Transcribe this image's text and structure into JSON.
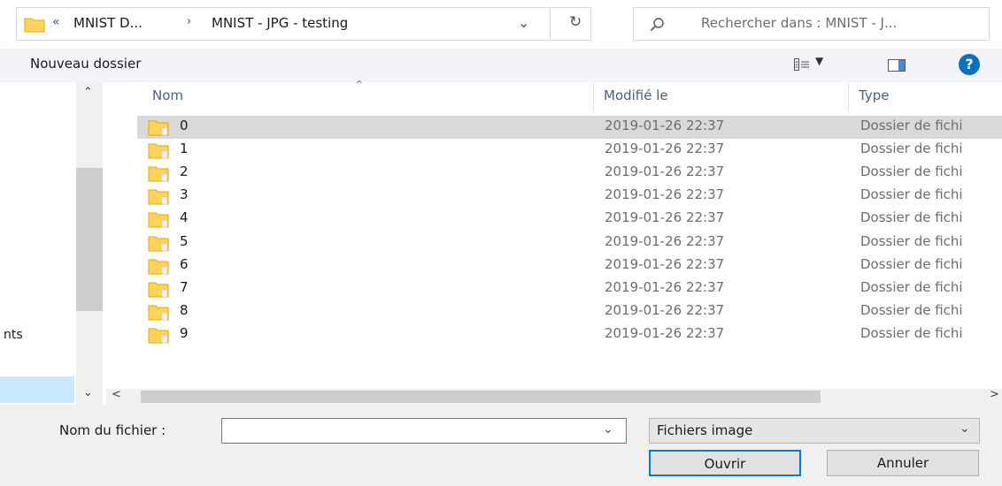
{
  "address": {
    "chevron": "«",
    "segment1": "MNIST D...",
    "separator": "›",
    "segment2": "MNIST - JPG - testing",
    "dropdown": "⌄",
    "refresh": "↻"
  },
  "search": {
    "placeholder": "Rechercher dans : MNIST - J..."
  },
  "toolbar": {
    "new_folder": "Nouveau dossier",
    "view_dropdown": "▼",
    "help": "?"
  },
  "nav": {
    "partial_label": "nts",
    "scroll_up": "⌃",
    "scroll_down": "⌄"
  },
  "list": {
    "sort_arrow": "⌃",
    "columns": {
      "name": "Nom",
      "modified": "Modifié le",
      "type": "Type"
    },
    "rows": [
      {
        "name": "0",
        "modified": "2019-01-26 22:37",
        "type": "Dossier de fichi"
      },
      {
        "name": "1",
        "modified": "2019-01-26 22:37",
        "type": "Dossier de fichi"
      },
      {
        "name": "2",
        "modified": "2019-01-26 22:37",
        "type": "Dossier de fichi"
      },
      {
        "name": "3",
        "modified": "2019-01-26 22:37",
        "type": "Dossier de fichi"
      },
      {
        "name": "4",
        "modified": "2019-01-26 22:37",
        "type": "Dossier de fichi"
      },
      {
        "name": "5",
        "modified": "2019-01-26 22:37",
        "type": "Dossier de fichi"
      },
      {
        "name": "6",
        "modified": "2019-01-26 22:37",
        "type": "Dossier de fichi"
      },
      {
        "name": "7",
        "modified": "2019-01-26 22:37",
        "type": "Dossier de fichi"
      },
      {
        "name": "8",
        "modified": "2019-01-26 22:37",
        "type": "Dossier de fichi"
      },
      {
        "name": "9",
        "modified": "2019-01-26 22:37",
        "type": "Dossier de fichi"
      }
    ],
    "scroll_left": "<",
    "scroll_right": ">"
  },
  "bottom": {
    "filename_label": "Nom du fichier :",
    "filename_value": "",
    "filename_dropdown": "⌄",
    "filetype_value": "Fichiers image",
    "filetype_dropdown": "⌄",
    "open_button": "Ouvrir",
    "cancel_button": "Annuler"
  },
  "colors": {
    "folder": "#ffd35c",
    "accent": "#0078d7",
    "selection": "#d9d9d9",
    "nav_selection": "#cce8ff",
    "help": "#0b6fc4"
  },
  "icons": [
    "folder-icon",
    "search-icon",
    "refresh-icon",
    "view-options-icon",
    "preview-pane-icon",
    "help-icon"
  ]
}
